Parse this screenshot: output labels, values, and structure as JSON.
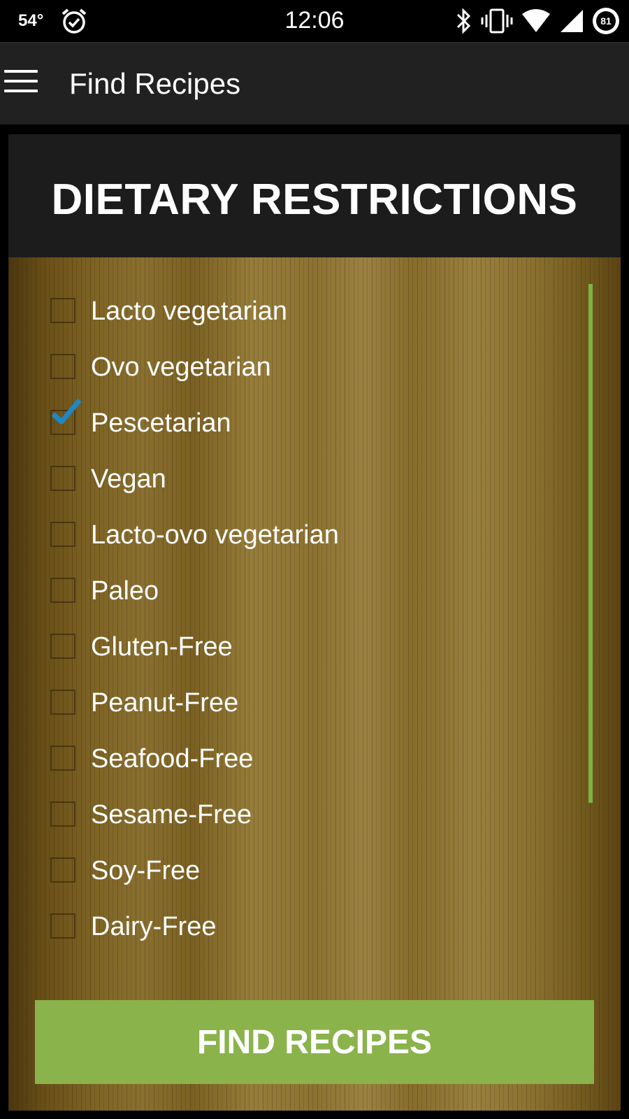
{
  "status_bar": {
    "temperature": "54°",
    "time": "12:06",
    "battery_level": "81",
    "icons": [
      "alarm-clock-icon",
      "bluetooth-icon",
      "vibrate-icon",
      "wifi-icon",
      "cell-signal-icon",
      "battery-icon"
    ]
  },
  "app_bar": {
    "title": "Find Recipes",
    "menu_icon": "hamburger-menu-icon"
  },
  "header": {
    "title": "DIETARY RESTRICTIONS"
  },
  "diet_options": [
    {
      "label": "Lacto vegetarian",
      "checked": false
    },
    {
      "label": "Ovo vegetarian",
      "checked": false
    },
    {
      "label": "Pescetarian",
      "checked": true
    },
    {
      "label": "Vegan",
      "checked": false
    },
    {
      "label": "Lacto-ovo vegetarian",
      "checked": false
    },
    {
      "label": "Paleo",
      "checked": false
    },
    {
      "label": "Gluten-Free",
      "checked": false
    },
    {
      "label": "Peanut-Free",
      "checked": false
    },
    {
      "label": "Seafood-Free",
      "checked": false
    },
    {
      "label": "Sesame-Free",
      "checked": false
    },
    {
      "label": "Soy-Free",
      "checked": false
    },
    {
      "label": "Dairy-Free",
      "checked": false
    }
  ],
  "action_button": {
    "label": "FIND RECIPES"
  },
  "colors": {
    "accent_green": "#8ab34b",
    "scrollbar_green": "#7cb342",
    "check_blue": "#1e88c8",
    "app_bar": "#212121",
    "header_panel": "#1c1c1c"
  }
}
